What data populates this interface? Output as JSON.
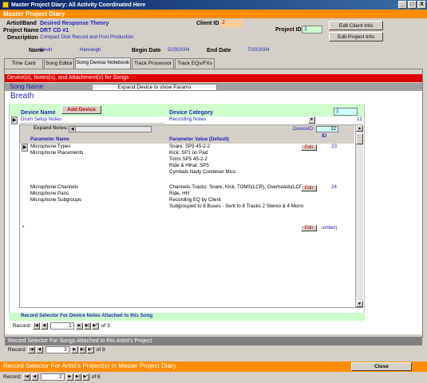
{
  "window": {
    "title": "Master Project Diary: All Activity Coordinated Here",
    "min": "_",
    "max": "□",
    "close": "X"
  },
  "form_title": "Master Project Diary",
  "header": {
    "artist_label": "Artist/Band",
    "artist_value": "Desired Response Theory",
    "project_label": "Project Name",
    "project_value": "DRT CD #1",
    "description_label": "Description",
    "description_value": "Compact Disk Record and Post Production",
    "client_id_label": "Client ID",
    "client_id_value": "2",
    "project_id_label": "Project ID",
    "project_id_value": "1",
    "edit_client_btn": "Edit Client Info",
    "edit_project_btn": "Edit Project Info",
    "name_label": "Name",
    "first_name": "Kevin",
    "last_name": "Henneigh",
    "begin_label": "Begin Date",
    "begin_value": "5/29/2004",
    "end_label": "End Date",
    "end_value": "7/30/2004"
  },
  "tabs": [
    "Time Card Editor",
    "Song Editor",
    "Song Device Notebook",
    "Track Processor",
    "Track EQs/FXs"
  ],
  "section_header": "Device(s), Notes(s), and Attachment(s) for Songs",
  "song": {
    "song_name_label": "Song Name",
    "expand_btn": "Expand Device to show Params",
    "song_name_value": "Breath"
  },
  "device": {
    "device_name_label": "Device Name",
    "add_device_btn": "Add Device",
    "device_category_label": "Device Category",
    "device_count": "2",
    "device_name_value": "Drum Setup Notes",
    "device_category_value": "Recording Notes",
    "device_id_value": "12",
    "expand_notes_label": "Expand Notes:",
    "device_id_label": "DeviceID:",
    "device_id_field": "12",
    "param_name_header": "Parameter Name",
    "param_value_header": "Parameter Value (Default)",
    "id_header": "ID",
    "edit_label": "Edit",
    "records": [
      {
        "names": [
          "Microphone Types",
          "Microphone Placements"
        ],
        "values": [
          "Snare:  SP9 45-2-2",
          "Kick: SP1 on Pad",
          "Toms SP5 45-2-2",
          "Ride & Hihat: SP5",
          "Cymbals Nady Condeser Mics"
        ],
        "id": "23"
      },
      {
        "names": [
          "Microphone Channels",
          "Microphone Pans",
          "Microphone Subgroups"
        ],
        "values": [
          "Channels-Tracks: Snare, Kick, TOMS(LCR), Overheads(LCR),",
          "Ride, HH",
          "Recording EQ by Client",
          "Subgrouped to 8 Buses - Sent to 8 Tracks 2 Stereo & 4 Mono"
        ],
        "id": "24"
      }
    ],
    "new_row_suffix": "umber)",
    "new_row_marker": "*"
  },
  "device_selector_label": "Record Selector For Device Notes Attached to this Song",
  "nav_device": {
    "label": "Record:",
    "current": "1",
    "of": "of 3"
  },
  "song_selector_label": "Record Selector For Songs Attached to this Artist's Project",
  "nav_song": {
    "label": "Record:",
    "current": "3",
    "of": "of 9"
  },
  "project_selector_label": "Record Selector For Artist's Project(s) in Master Project Diary",
  "close_btn": "Close",
  "nav_project": {
    "label": "Record:",
    "current": "2",
    "of": "of 6"
  },
  "colors": {
    "orange": "#ff8c00",
    "red": "#e00000",
    "blue_text": "#1f1fb8",
    "green_field": "#ccffcc",
    "cyan_field": "#ccffff"
  }
}
